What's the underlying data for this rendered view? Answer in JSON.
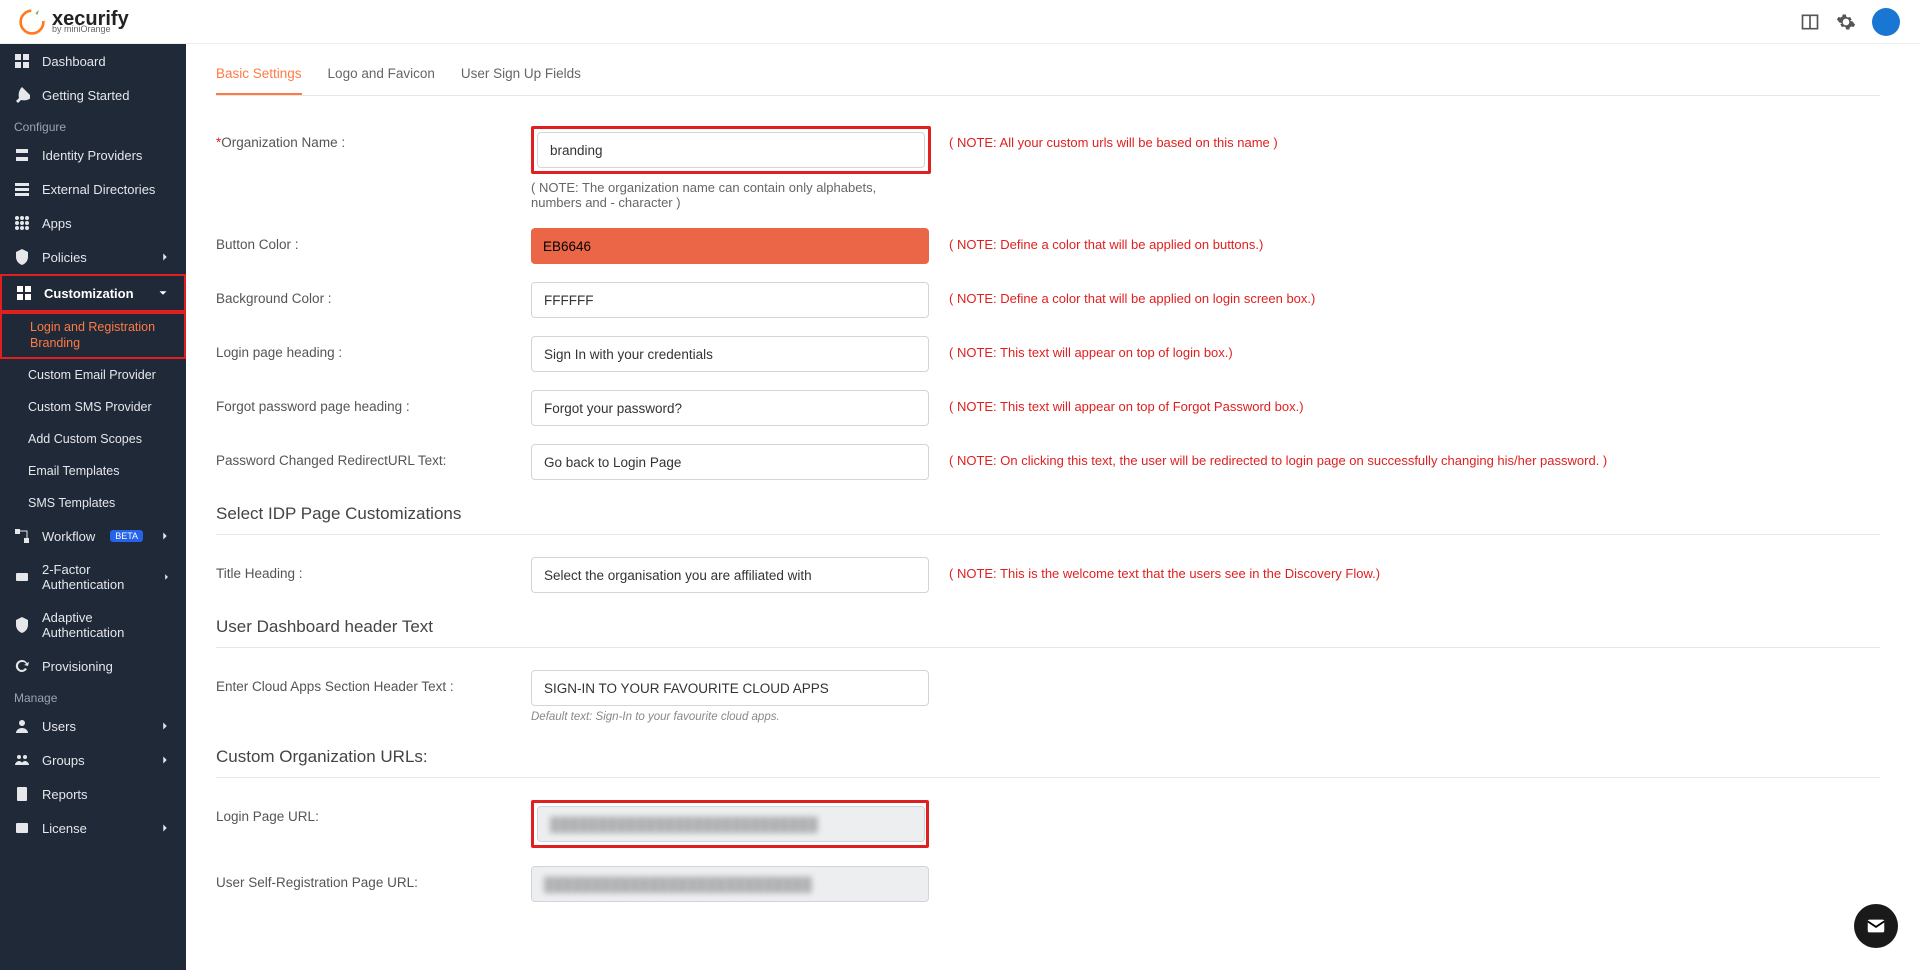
{
  "header": {
    "brand": "xecurify",
    "sub_brand": "by miniOrange"
  },
  "sidebar": {
    "section_configure": "Configure",
    "section_manage": "Manage",
    "items": {
      "dashboard": "Dashboard",
      "getting_started": "Getting Started",
      "identity_providers": "Identity Providers",
      "external_directories": "External Directories",
      "apps": "Apps",
      "policies": "Policies",
      "customization": "Customization",
      "workflow": "Workflow",
      "workflow_badge": "BETA",
      "two_factor": "2-Factor Authentication",
      "adaptive": "Adaptive Authentication",
      "provisioning": "Provisioning",
      "users": "Users",
      "groups": "Groups",
      "reports": "Reports",
      "license": "License"
    },
    "customization_sub": {
      "login_branding": "Login and Registration Branding",
      "custom_email": "Custom Email Provider",
      "custom_sms": "Custom SMS Provider",
      "add_scopes": "Add Custom Scopes",
      "email_templates": "Email Templates",
      "sms_templates": "SMS Templates"
    }
  },
  "tabs": {
    "basic": "Basic Settings",
    "logo": "Logo and Favicon",
    "signup": "User Sign Up Fields"
  },
  "form": {
    "org_name_label": "Organization Name :",
    "org_name_value": "branding",
    "org_name_note": "( NOTE: All your custom urls will be based on this name )",
    "org_name_subnote": "( NOTE: The organization name can contain only alphabets, numbers and - character )",
    "button_color_label": "Button Color :",
    "button_color_value": "EB6646",
    "button_color_note": "( NOTE: Define a color that will be applied on buttons.)",
    "bg_color_label": "Background Color :",
    "bg_color_value": "FFFFFF",
    "bg_color_note": "( NOTE: Define a color that will be applied on login screen box.)",
    "login_heading_label": "Login page heading :",
    "login_heading_value": "Sign In with your credentials",
    "login_heading_note": "( NOTE: This text will appear on top of login box.)",
    "forgot_heading_label": "Forgot password page heading :",
    "forgot_heading_value": "Forgot your password?",
    "forgot_heading_note": "( NOTE: This text will appear on top of Forgot Password box.)",
    "pwd_changed_label": "Password Changed RedirectURL Text:",
    "pwd_changed_value": "Go back to Login Page",
    "pwd_changed_note": "( NOTE: On clicking this text, the user will be redirected to login page on successfully changing his/her password. )",
    "section_idp": "Select IDP Page Customizations",
    "title_heading_label": "Title Heading :",
    "title_heading_value": "Select the organisation you are affiliated with",
    "title_heading_note": "( NOTE: This is the welcome text that the users see in the Discovery Flow.)",
    "section_dashboard": "User Dashboard header Text",
    "cloud_apps_label": "Enter Cloud Apps Section Header Text :",
    "cloud_apps_value": "SIGN-IN TO YOUR FAVOURITE CLOUD APPS",
    "cloud_apps_hint": "Default text: Sign-In to your favourite cloud apps.",
    "section_urls": "Custom Organization URLs:",
    "login_url_label": "Login Page URL:",
    "selfreg_url_label": "User Self-Registration Page URL:"
  }
}
